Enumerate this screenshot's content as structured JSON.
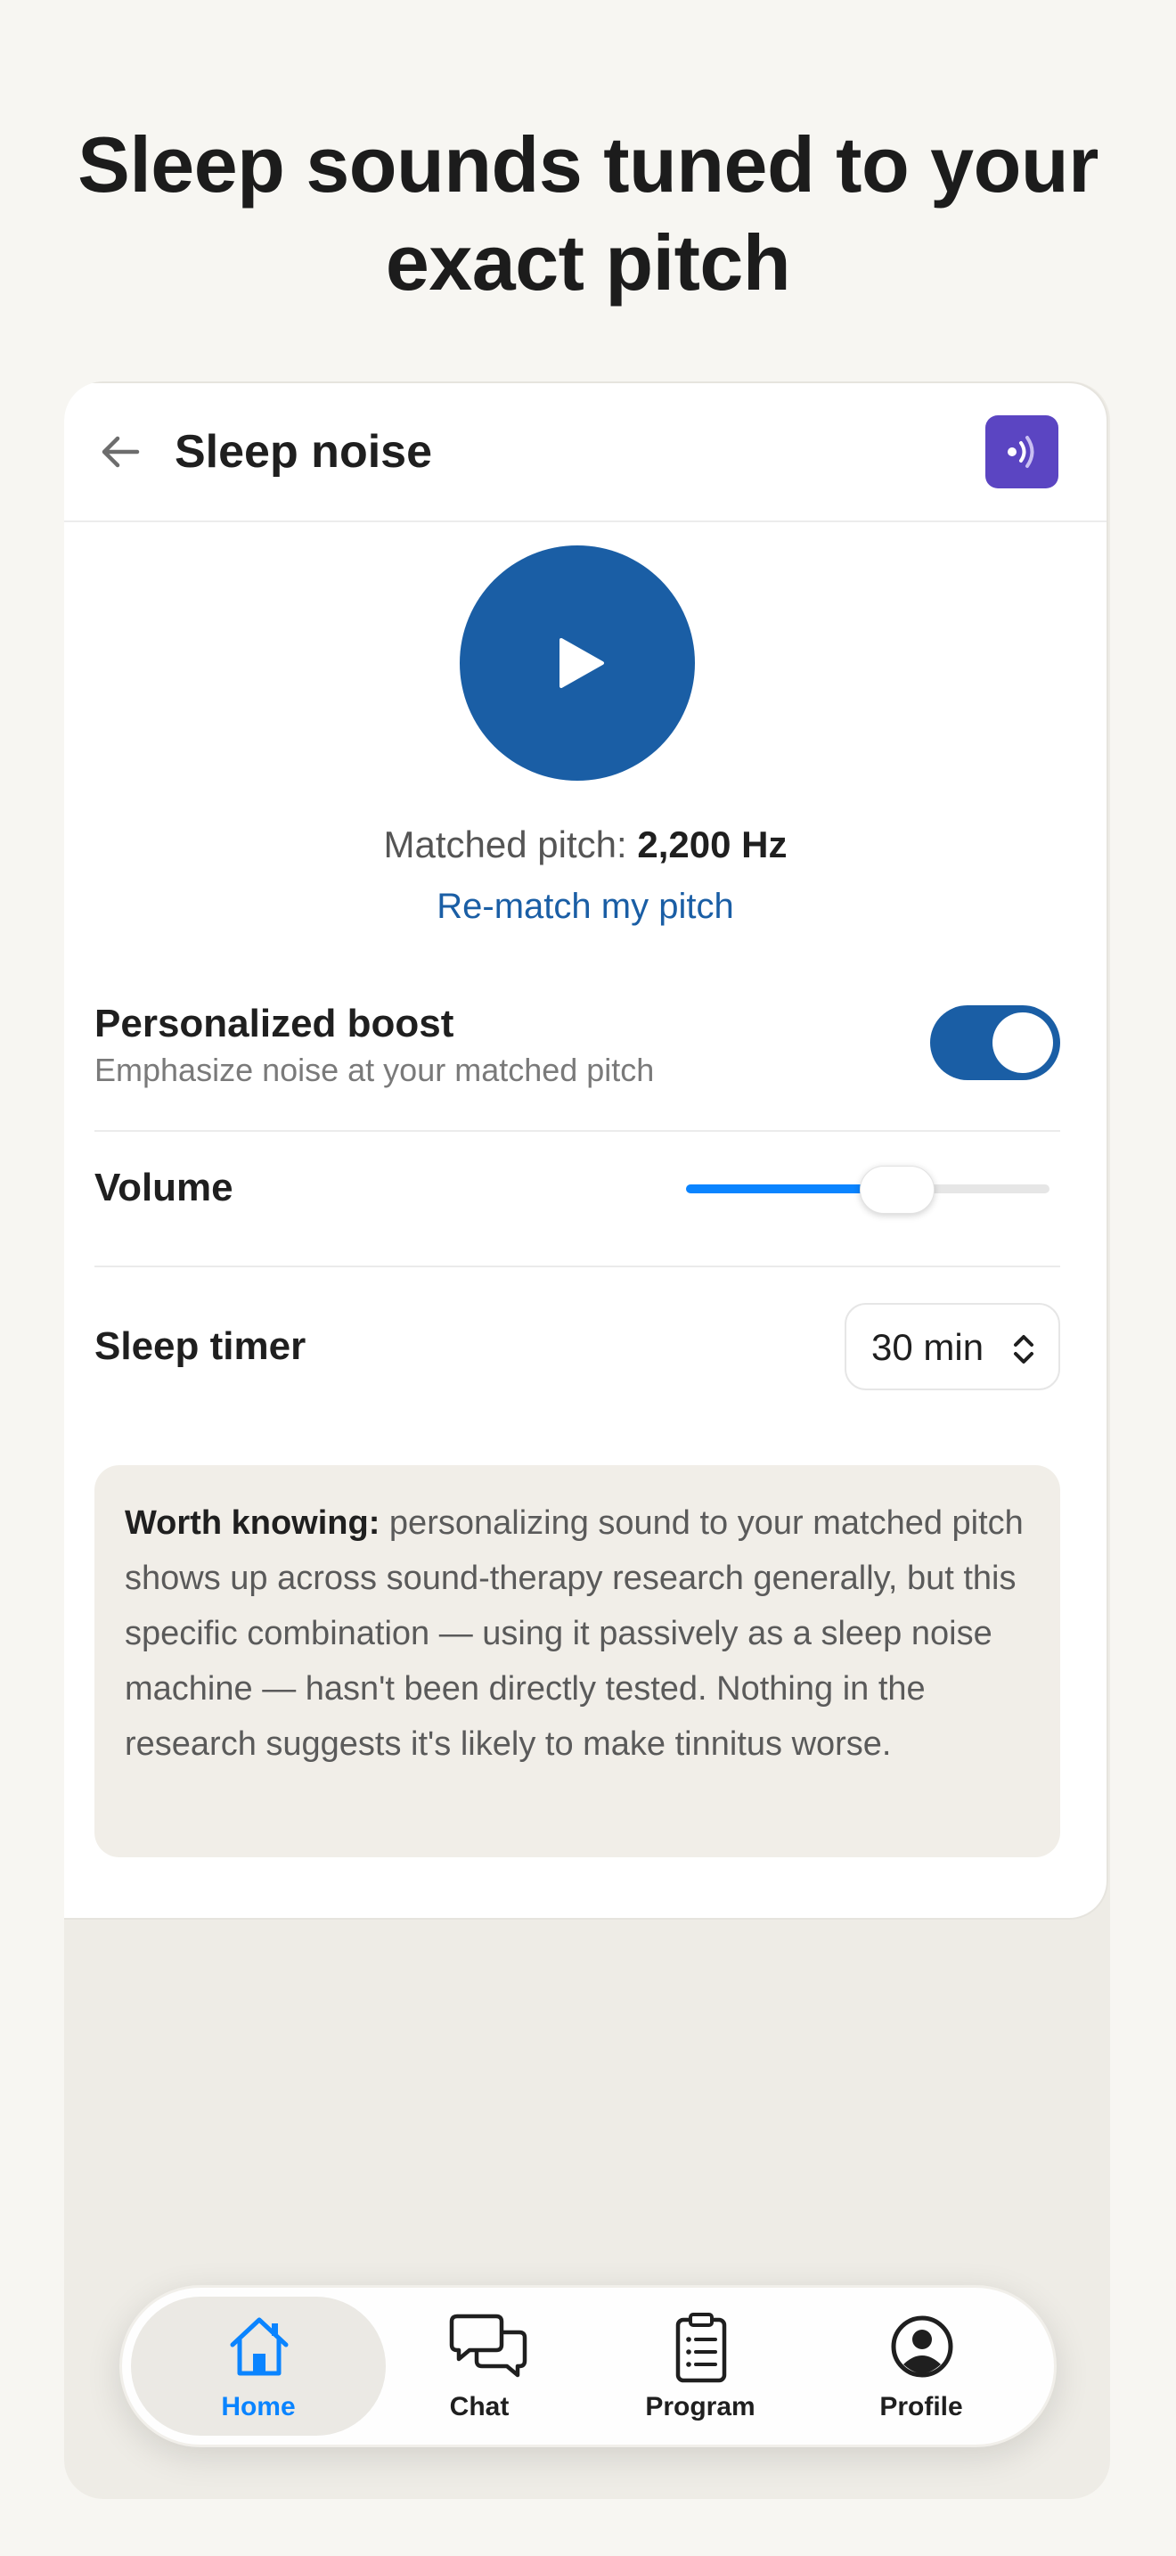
{
  "headline": {
    "line1": "Sleep sounds tuned to your",
    "line2": "exact pitch"
  },
  "appbar": {
    "title": "Sleep noise",
    "badge_icon": "sound-wave-icon",
    "badge_color": "#5b45c2"
  },
  "player": {
    "play_icon": "play-icon",
    "accent_color": "#1a5ea5",
    "pitch_label": "Matched pitch:",
    "pitch_value": "2,200 Hz",
    "rematch_label": "Re-match my pitch"
  },
  "settings": {
    "boost": {
      "title": "Personalized boost",
      "subtitle": "Emphasize noise at your matched pitch",
      "enabled": true
    },
    "volume": {
      "label": "Volume",
      "level": 0.58
    },
    "timer": {
      "label": "Sleep timer",
      "value": "30 min"
    }
  },
  "note": {
    "lead": "Worth knowing:",
    "body": "personalizing sound to your matched pitch shows up across sound-therapy research generally, but this specific combination — using it passively as a sleep noise machine — hasn't been directly tested. Nothing in the research suggests it's likely to make tinnitus worse."
  },
  "tabs": [
    {
      "label": "Home",
      "icon": "home-icon",
      "active": true
    },
    {
      "label": "Chat",
      "icon": "chat-icon",
      "active": false
    },
    {
      "label": "Program",
      "icon": "clipboard-icon",
      "active": false
    },
    {
      "label": "Profile",
      "icon": "profile-icon",
      "active": false
    }
  ],
  "colors": {
    "active_tab": "#0a84ff",
    "slider_fill": "#0a84ff"
  }
}
